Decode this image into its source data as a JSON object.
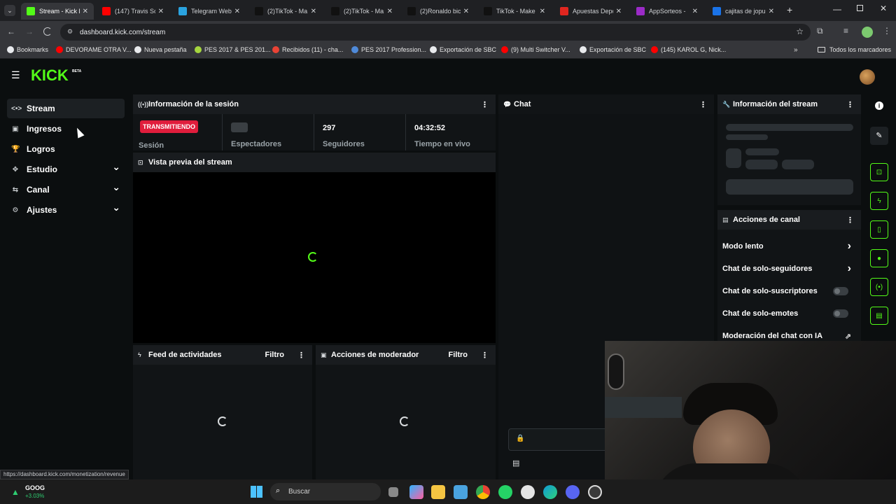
{
  "browser": {
    "tabs": [
      {
        "title": "Stream - Kick D",
        "active": true,
        "fav_color": "#53fc18"
      },
      {
        "title": "(147) Travis Sc",
        "active": false,
        "fav_color": "#ff0000"
      },
      {
        "title": "Telegram Web",
        "active": false,
        "fav_color": "#2aa3e0"
      },
      {
        "title": "(2)TikTok - Ma",
        "active": false,
        "fav_color": "#111111"
      },
      {
        "title": "(2)TikTok - Ma",
        "active": false,
        "fav_color": "#111111"
      },
      {
        "title": "(2)Ronaldo bic",
        "active": false,
        "fav_color": "#111111"
      },
      {
        "title": "TikTok - Make",
        "active": false,
        "fav_color": "#111111"
      },
      {
        "title": "Apuestas Depc",
        "active": false,
        "fav_color": "#e0261f"
      },
      {
        "title": "AppSorteos - ",
        "active": false,
        "fav_color": "#9b2bc7"
      },
      {
        "title": "cajitas de jopu",
        "active": false,
        "fav_color": "#1a73e8"
      }
    ],
    "url": "dashboard.kick.com/stream",
    "bookmarks": [
      {
        "label": "Bookmarks",
        "color": "#e8eaed"
      },
      {
        "label": "DEVORAME OTRA V...",
        "color": "#ff0000"
      },
      {
        "label": "Nueva pestaña",
        "color": "#e8eaed"
      },
      {
        "label": "PES 2017 & PES 201...",
        "color": "#a5d63f"
      },
      {
        "label": "Recibidos (11) - cha...",
        "color": "#ea4335"
      },
      {
        "label": "PES 2017 Profession...",
        "color": "#4f8ad9"
      },
      {
        "label": "Exportación de SBC",
        "color": "#e8eaed"
      },
      {
        "label": "(9) Multi Switcher V...",
        "color": "#ff0000"
      },
      {
        "label": "Exportación de SBC",
        "color": "#e8eaed"
      },
      {
        "label": "(145) KAROL G, Nick...",
        "color": "#ff0000"
      }
    ],
    "all_bookmarks": "Todos los marcadores",
    "status_url": "https://dashboard.kick.com/monetization/revenue"
  },
  "app": {
    "logo": "KICK",
    "logo_badge": "BETA",
    "accent": "#53fc18",
    "sidebar": [
      {
        "label": "Stream",
        "icon": "stream-icon",
        "active": true,
        "expandable": false
      },
      {
        "label": "Ingresos",
        "icon": "revenue-icon",
        "active": false,
        "expandable": false
      },
      {
        "label": "Logros",
        "icon": "trophy-icon",
        "active": false,
        "expandable": false
      },
      {
        "label": "Estudio",
        "icon": "studio-icon",
        "active": false,
        "expandable": true
      },
      {
        "label": "Canal",
        "icon": "channel-icon",
        "active": false,
        "expandable": true
      },
      {
        "label": "Ajustes",
        "icon": "settings-icon",
        "active": false,
        "expandable": true
      }
    ],
    "session": {
      "title": "Información de la sesión",
      "live_badge": "TRANSMITIENDO",
      "session_label": "Sesión",
      "viewers_label": "Espectadores",
      "followers_value": "297",
      "followers_label": "Seguidores",
      "uptime_value": "04:32:52",
      "uptime_label": "Tiempo en vivo"
    },
    "preview": {
      "title": "Vista previa del stream"
    },
    "activity": {
      "title": "Feed de actividades",
      "filter": "Filtro"
    },
    "modactions": {
      "title": "Acciones de moderador",
      "filter": "Filtro"
    },
    "chat": {
      "title": "Chat"
    },
    "stream_info": {
      "title": "Información del stream"
    },
    "channel_actions": {
      "title": "Acciones de canal",
      "items": [
        {
          "label": "Modo lento",
          "kind": "arrow"
        },
        {
          "label": "Chat de solo-seguidores",
          "kind": "arrow"
        },
        {
          "label": "Chat de solo-suscriptores",
          "kind": "toggle",
          "on": false
        },
        {
          "label": "Chat de solo-emotes",
          "kind": "toggle",
          "on": false
        },
        {
          "label": "Moderación del chat con IA",
          "kind": "external"
        }
      ]
    }
  },
  "taskbar": {
    "stock_symbol": "GOOG",
    "stock_change": "+3.03%",
    "search_label": "Buscar"
  }
}
